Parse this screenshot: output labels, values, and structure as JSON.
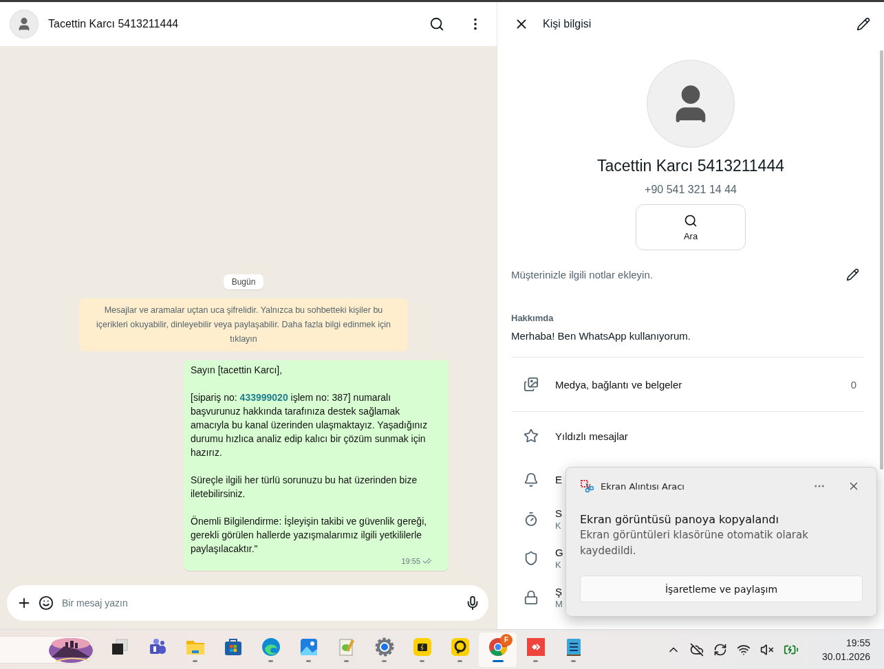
{
  "chat": {
    "header": {
      "title": "Tacettin Karcı 5413211444"
    },
    "date_chip": "Bugün",
    "notice": "Mesajlar ve aramalar uçtan uca şifrelidir. Yalnızca bu sohbetteki kişiler bu içerikleri okuyabilir, dinleyebilir veya paylaşabilir. Daha fazla bilgi edinmek için tıklayın",
    "messages": [
      {
        "paragraphs": [
          "Sayın [tacettin Karcı],",
          "[sipariş no: **433999020** işlem no: 387] numaralı başvurunuz hakkında tarafınıza destek sağlamak amacıyla bu kanal üzerinden ulaşmaktayız. Yaşadığınız durumu hızlıca analiz edip kalıcı bir çözüm sunmak için hazırız.",
          "Süreçle ilgili her türlü sorunuzu bu hat üzerinden bize iletebilirsiniz.",
          "Önemli Bilgilendirme: İşleyişin takibi ve güvenlik gereği, gerekli görülen hallerde yazışmalarımız ilgili yetkililerle paylaşılacaktır.\""
        ],
        "time": "19:55"
      }
    ],
    "composer": {
      "placeholder": "Bir mesaj yazın"
    }
  },
  "contact_info": {
    "title": "Kişi bilgisi",
    "name": "Tacettin Karcı 5413211444",
    "phone": "+90 541 321 14 44",
    "action": "Ara",
    "notes": "Müşterinizle ilgili notlar ekleyin.",
    "about_label": "Hakkımda",
    "about": "Merhaba! Ben WhatsApp kullanıyorum.",
    "rows": [
      {
        "kind": "media",
        "label": "Medya, bağlantı ve belgeler",
        "count": "0"
      },
      {
        "kind": "starred",
        "label": "Yıldızlı mesajlar"
      },
      {
        "kind": "notifications",
        "label": "E"
      },
      {
        "kind": "timer",
        "label": "S",
        "sub": "K"
      },
      {
        "kind": "privacy",
        "label": "G",
        "sub": "K"
      },
      {
        "kind": "lock",
        "label": "Ş",
        "sub": "M"
      }
    ]
  },
  "toast": {
    "app": "Ekran Alıntısı Aracı",
    "title": "Ekran görüntüsü panoya kopyalandı",
    "body": "Ekran görüntüleri klasörüne otomatik olarak kaydedildi.",
    "button": "İşaretleme ve paylaşım"
  },
  "taskbar": {
    "apps": [
      {
        "kind": "taskview",
        "running": false,
        "selected": false
      },
      {
        "kind": "teams",
        "running": false,
        "selected": false
      },
      {
        "kind": "explorer",
        "running": true,
        "selected": false
      },
      {
        "kind": "store",
        "running": false,
        "selected": false
      },
      {
        "kind": "edge",
        "running": true,
        "selected": false
      },
      {
        "kind": "photos",
        "running": true,
        "selected": false
      },
      {
        "kind": "editor",
        "running": true,
        "selected": false
      },
      {
        "kind": "settings",
        "running": true,
        "selected": false
      },
      {
        "kind": "yellow",
        "running": true,
        "selected": false
      },
      {
        "kind": "remote",
        "running": true,
        "selected": false
      },
      {
        "kind": "chrome",
        "running": true,
        "selected": true,
        "badge": "F"
      },
      {
        "kind": "anydesk",
        "running": true,
        "selected": false
      },
      {
        "kind": "notepad",
        "running": true,
        "selected": false
      }
    ],
    "time": "19:55",
    "date": "30.01.2026"
  }
}
